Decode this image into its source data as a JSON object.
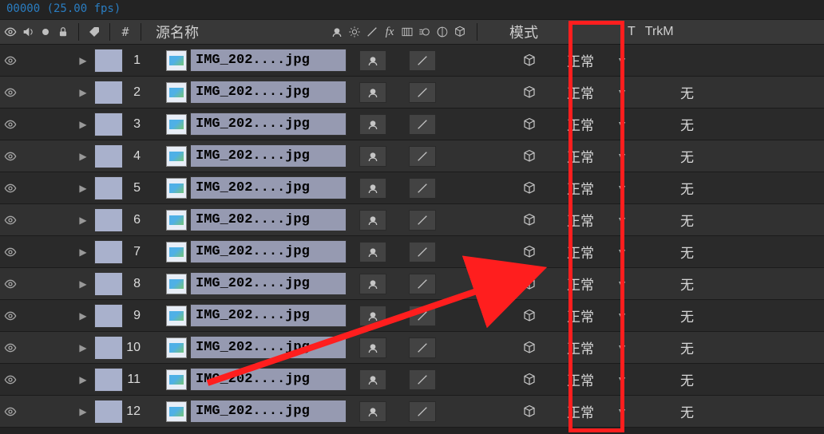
{
  "top_line": "00000 (25.00 fps)",
  "header": {
    "source_name": "源名称",
    "mode": "模式",
    "t_col": "T",
    "trkmat": "TrkM"
  },
  "mode_default": "正常",
  "tmat_default": "无",
  "layers": [
    {
      "num": "1",
      "name": "IMG_202....jpg",
      "first": true
    },
    {
      "num": "2",
      "name": "IMG_202....jpg"
    },
    {
      "num": "3",
      "name": "IMG_202....jpg"
    },
    {
      "num": "4",
      "name": "IMG_202....jpg"
    },
    {
      "num": "5",
      "name": "IMG_202....jpg"
    },
    {
      "num": "6",
      "name": "IMG_202....jpg"
    },
    {
      "num": "7",
      "name": "IMG_202....jpg"
    },
    {
      "num": "8",
      "name": "IMG_202....jpg"
    },
    {
      "num": "9",
      "name": "IMG_202....jpg"
    },
    {
      "num": "10",
      "name": "IMG_202....jpg"
    },
    {
      "num": "11",
      "name": "IMG_202....jpg"
    },
    {
      "num": "12",
      "name": "IMG_202....jpg"
    }
  ]
}
